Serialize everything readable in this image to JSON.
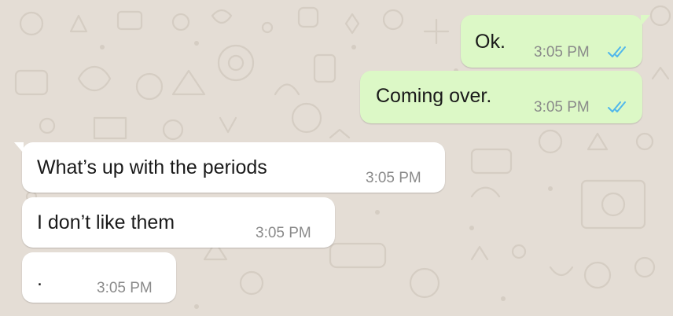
{
  "chat": {
    "messages": [
      {
        "direction": "outgoing",
        "text": "Ok.",
        "time": "3:05 PM",
        "status": "read-double-check-icon"
      },
      {
        "direction": "outgoing",
        "text": "Coming over.",
        "time": "3:05 PM",
        "status": "read-double-check-icon"
      },
      {
        "direction": "incoming",
        "text": "What’s up with the periods",
        "time": "3:05 PM"
      },
      {
        "direction": "incoming",
        "text": "I don’t like them",
        "time": "3:05 PM"
      },
      {
        "direction": "incoming",
        "text": ".",
        "time": "3:05 PM"
      }
    ]
  },
  "colors": {
    "wallpaper": "#e4ddd5",
    "outgoing_bubble": "#dcf8c6",
    "incoming_bubble": "#ffffff",
    "read_tick": "#4fb6ec",
    "timestamp": "#8a8a8a"
  }
}
